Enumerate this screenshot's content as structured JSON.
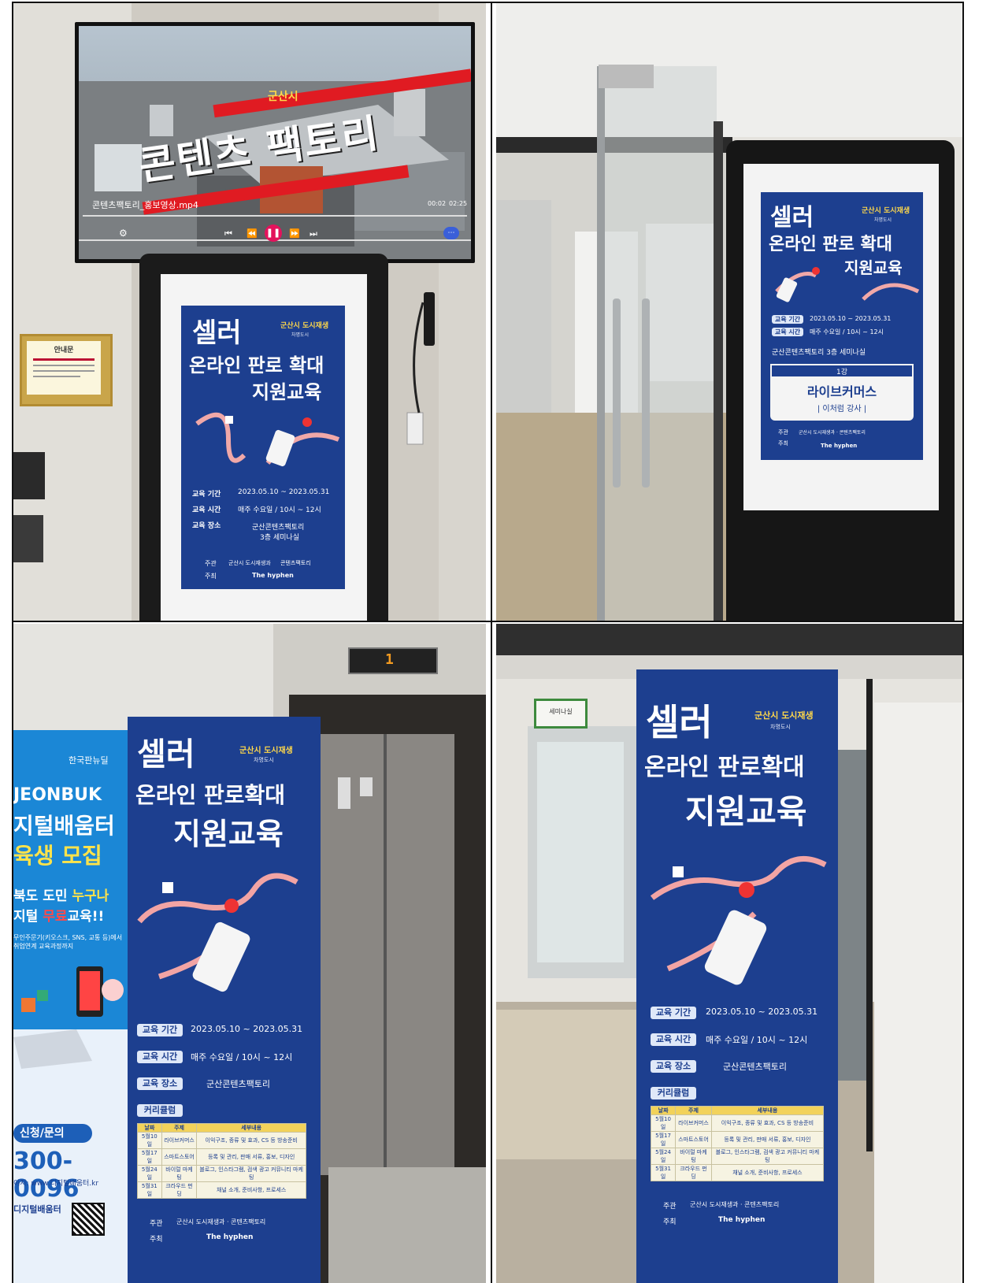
{
  "video": {
    "title_small": "군산시",
    "title_big": "콘텐츠 팩토리",
    "filename": "콘텐츠팩토리_홍보영상.mp4",
    "time_current": "00:02",
    "time_total": "02:25"
  },
  "board": {
    "title": "안내문"
  },
  "poster": {
    "line1": "셀러",
    "line2": "온라인 판로확대",
    "line2_spaced": "온라인 판로 확대",
    "line3": "지원교육",
    "org": "군산시 도시재생",
    "org_sub": "차명도시 ",
    "labels": {
      "period": "교육 기간",
      "time": "교육 시간",
      "place": "교육 장소",
      "curriculum": "커리큘럼"
    },
    "values": {
      "period": "2023.05.10 ~ 2023.05.31",
      "time": "매주 수요일 / 10시 ~ 12시",
      "place": "군산콘텐츠팩토리",
      "place_line2": "3층 세미나실",
      "place_full": "군산콘텐츠팩토리 3층 세미나실"
    },
    "host_label": "주관",
    "organizer_label": "주최",
    "host": "군산시 도시재생과 · 콘텐츠팩토리",
    "host_short": "군산시 도시재생과",
    "host_short2": "콘텐츠팩토리",
    "organizer": "The hyphen",
    "lecture_no": "1강",
    "lecture_title": "라이브커머스",
    "lecturer": "| 이처럼 강사 |",
    "curriculum": {
      "headers": [
        "날짜",
        "주제",
        "세부내용"
      ],
      "rows": [
        [
          "5월10일",
          "라이브커머스",
          "이익구조, 종류 및 효과, CS 등 방송준비"
        ],
        [
          "5월17일",
          "스마트스토어",
          "등록 및 관리, 판매 서류, 홍보, 디자인"
        ],
        [
          "5월24일",
          "바이럴 마케팅",
          "블로그, 인스타그램, 검색 광고 커뮤니티 마케팅"
        ],
        [
          "5월31일",
          "크라우드 펀딩",
          "채널 소개, 준비사항, 프로세스"
        ]
      ]
    }
  },
  "left_poster": {
    "brand": "한국판뉴딜",
    "line1": "JEONBUK",
    "line2": "지털배움터",
    "line3": "육생 모집",
    "line4a": "북도 도민 ",
    "line4b": "누구나",
    "line5a": "지털 ",
    "line5b": "무료",
    "line5c": "교육!!",
    "desc": "무인주문기(키오스크, SNS, 교통 등)에서 취업연계 교육과정까지",
    "apply": "신청/문의",
    "phone": "300-0096",
    "url": "이지: www.디지털배움터.kr",
    "footer1": "디지털배움터"
  },
  "elevator": {
    "floor": "1"
  },
  "room_sign": {
    "label": "세미나실"
  }
}
